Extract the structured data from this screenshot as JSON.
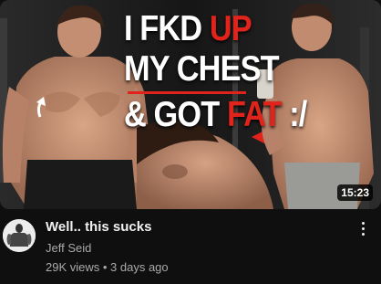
{
  "thumbnail": {
    "headline": {
      "line1_white": "I FKD ",
      "line1_red": "UP",
      "line2_white": "MY CHEST",
      "line3_white": "& GOT ",
      "line3_red": "FAT",
      "line3_tail": " :/"
    },
    "duration": "15:23",
    "accent_color": "#e0241c"
  },
  "video": {
    "title": "Well.. this sucks",
    "channel": "Jeff Seid",
    "views": "29K views",
    "separator": " • ",
    "age": "3 days ago"
  },
  "icons": {
    "more": "vertical-ellipsis-icon",
    "avatar": "channel-avatar"
  }
}
